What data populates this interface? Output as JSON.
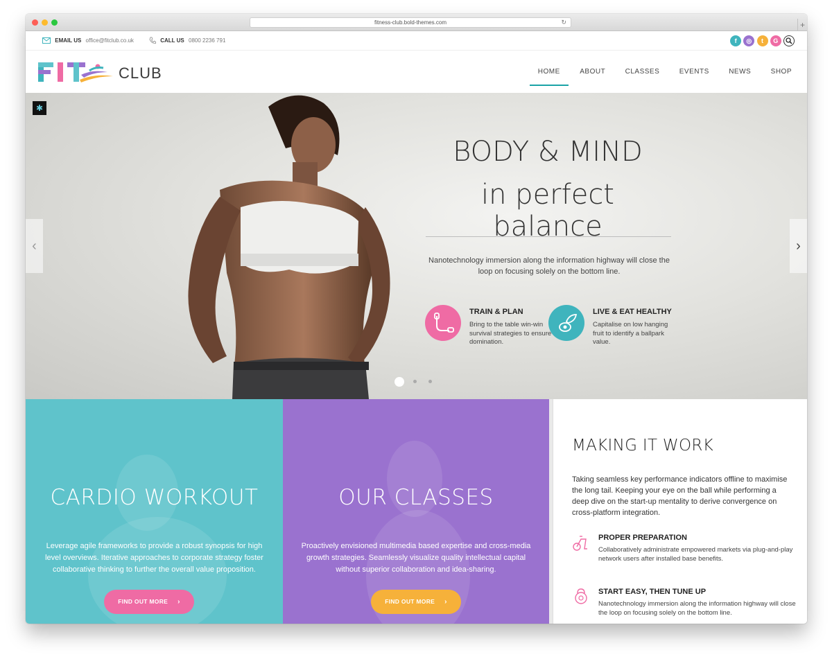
{
  "browser": {
    "url": "fitness-club.bold-themes.com"
  },
  "topbar": {
    "email_label": "EMAIL US",
    "email_value": "office@fitclub.co.uk",
    "phone_label": "CALL US",
    "phone_value": "0800 2236 791",
    "socials": [
      {
        "name": "facebook-icon",
        "glyph": "f",
        "color": "#3fb4bd"
      },
      {
        "name": "instagram-icon",
        "glyph": "◎",
        "color": "#9a72cf"
      },
      {
        "name": "twitter-icon",
        "glyph": "t",
        "color": "#f6b13a"
      },
      {
        "name": "google-plus-icon",
        "glyph": "G",
        "color": "#ef6ba4"
      }
    ]
  },
  "header": {
    "logo_fit": "FIT",
    "logo_club": "CLUB",
    "nav": [
      "HOME",
      "ABOUT",
      "CLASSES",
      "EVENTS",
      "NEWS",
      "SHOP"
    ],
    "active_nav": "HOME"
  },
  "hero": {
    "title_line1": "BODY & MIND",
    "title_line2": "in perfect balance",
    "text": "Nanotechnology immersion along the information highway will close the loop on focusing solely on the bottom line.",
    "features": [
      {
        "title": "TRAIN & PLAN",
        "text": "Bring to the table win-win survival strategies to ensure domination.",
        "color": "#ef6ba4",
        "icon": "jump-rope-icon"
      },
      {
        "title": "LIVE & EAT HEALTHY",
        "text": "Capitalise on low hanging fruit to identify a ballpark value.",
        "color": "#3fb4bd",
        "icon": "healthy-food-icon"
      }
    ],
    "slides": 3,
    "active_slide": 1
  },
  "panels": {
    "cardio": {
      "title": "CARDIO WORKOUT",
      "text": "Leverage agile frameworks to provide a robust synopsis for high level overviews. Iterative approaches to corporate strategy foster collaborative thinking to further the overall value proposition.",
      "button": "FIND OUT MORE",
      "button_color": "#ef6ba4"
    },
    "classes": {
      "title": "OUR CLASSES",
      "text": "Proactively envisioned multimedia based expertise and cross-media growth strategies. Seamlessly visualize quality intellectual capital without superior collaboration and idea-sharing.",
      "button": "FIND OUT MORE",
      "button_color": "#f6b13a"
    },
    "work": {
      "title": "MAKING IT WORK",
      "text": "Taking seamless key performance indicators offline to maximise the long tail. Keeping your eye on the ball while performing a deep dive on the start-up mentality to derive convergence on cross-platform integration.",
      "features": [
        {
          "title": "PROPER PREPARATION",
          "text": "Collaboratively administrate empowered markets via plug-and-play network users after installed base benefits.",
          "icon": "exercise-bike-icon"
        },
        {
          "title": "START EASY, THEN TUNE UP",
          "text": "Nanotechnology immersion along the information highway will close the loop on focusing solely on the bottom line.",
          "icon": "kettlebell-icon"
        }
      ]
    }
  }
}
